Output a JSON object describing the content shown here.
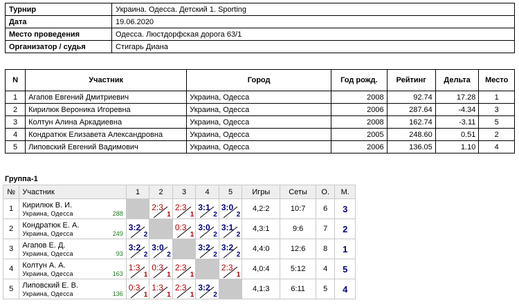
{
  "info": [
    {
      "label": "Турнир",
      "value": "Украина. Одесса. Детский 1. Sporting"
    },
    {
      "label": "Дата",
      "value": "19.06.2020"
    },
    {
      "label": "Место проведения",
      "value": "Одесса. Люстдорфская дорога 63/1"
    },
    {
      "label": "Организатор / судья",
      "value": "Стигарь Диана"
    }
  ],
  "participants": {
    "headers": [
      "N",
      "Участник",
      "Город",
      "Год рожд.",
      "Рейтинг",
      "Дельта",
      "Место"
    ],
    "rows": [
      {
        "n": "1",
        "name": "Агапов Евгений Дмитриевич",
        "city": "Украина, Одесса",
        "year": "2008",
        "rating": "92.74",
        "delta": "17.28",
        "place": "1"
      },
      {
        "n": "2",
        "name": "Кирилюк Вероника Игоревна",
        "city": "Украина, Одесса",
        "year": "2006",
        "rating": "287.64",
        "delta": "-4.34",
        "place": "3"
      },
      {
        "n": "3",
        "name": "Колтун Алина Аркадиевна",
        "city": "Украина, Одесса",
        "year": "2008",
        "rating": "162.74",
        "delta": "-3.11",
        "place": "5"
      },
      {
        "n": "4",
        "name": "Кондратюк Елизавета Александровна",
        "city": "Украина, Одесса",
        "year": "2005",
        "rating": "248.60",
        "delta": "0.51",
        "place": "2"
      },
      {
        "n": "5",
        "name": "Липовский Евгений Вадимович",
        "city": "Украина, Одесса",
        "year": "2006",
        "rating": "136.05",
        "delta": "1.10",
        "place": "4"
      }
    ]
  },
  "group": {
    "title": "Группа-1",
    "headers": [
      "№",
      "Участник",
      "1",
      "2",
      "3",
      "4",
      "5",
      "Игры",
      "Сеты",
      "О.",
      "М."
    ],
    "rows": [
      {
        "n": "1",
        "name": "Кирилюк В. И.",
        "city": "Украина, Одесса",
        "rating": "288",
        "cells": [
          null,
          {
            "s": "2:3",
            "p": "1",
            "win": false
          },
          {
            "s": "2:3",
            "p": "1",
            "win": false
          },
          {
            "s": "3:1",
            "p": "2",
            "win": true
          },
          {
            "s": "3:0",
            "p": "2",
            "win": true
          }
        ],
        "games": "4,2:2",
        "sets": "10:7",
        "points": "6",
        "place": "3"
      },
      {
        "n": "2",
        "name": "Кондратюк Е. А.",
        "city": "Украина, Одесса",
        "rating": "249",
        "cells": [
          {
            "s": "3:2",
            "p": "2",
            "win": true
          },
          null,
          {
            "s": "0:3",
            "p": "1",
            "win": false
          },
          {
            "s": "3:0",
            "p": "2",
            "win": true
          },
          {
            "s": "3:1",
            "p": "2",
            "win": true
          }
        ],
        "games": "4,3:1",
        "sets": "9:6",
        "points": "7",
        "place": "2"
      },
      {
        "n": "3",
        "name": "Агапов Е. Д.",
        "city": "Украина, Одесса",
        "rating": "93",
        "cells": [
          {
            "s": "3:2",
            "p": "2",
            "win": true
          },
          {
            "s": "3:0",
            "p": "2",
            "win": true
          },
          null,
          {
            "s": "3:2",
            "p": "2",
            "win": true
          },
          {
            "s": "3:2",
            "p": "2",
            "win": true
          }
        ],
        "games": "4,4:0",
        "sets": "12:6",
        "points": "8",
        "place": "1"
      },
      {
        "n": "4",
        "name": "Колтун А. А.",
        "city": "Украина, Одесса",
        "rating": "163",
        "cells": [
          {
            "s": "1:3",
            "p": "1",
            "win": false
          },
          {
            "s": "0:3",
            "p": "1",
            "win": false
          },
          {
            "s": "2:3",
            "p": "1",
            "win": false
          },
          null,
          {
            "s": "2:3",
            "p": "1",
            "win": false
          }
        ],
        "games": "4,0:4",
        "sets": "5:12",
        "points": "4",
        "place": "5"
      },
      {
        "n": "5",
        "name": "Липовский Е. В.",
        "city": "Украина, Одесса",
        "rating": "136",
        "cells": [
          {
            "s": "0:3",
            "p": "1",
            "win": false
          },
          {
            "s": "1:3",
            "p": "1",
            "win": false
          },
          {
            "s": "2:3",
            "p": "1",
            "win": false
          },
          {
            "s": "3:2",
            "p": "2",
            "win": true
          },
          null
        ],
        "games": "4,1:3",
        "sets": "6:11",
        "points": "5",
        "place": "4"
      }
    ]
  }
}
